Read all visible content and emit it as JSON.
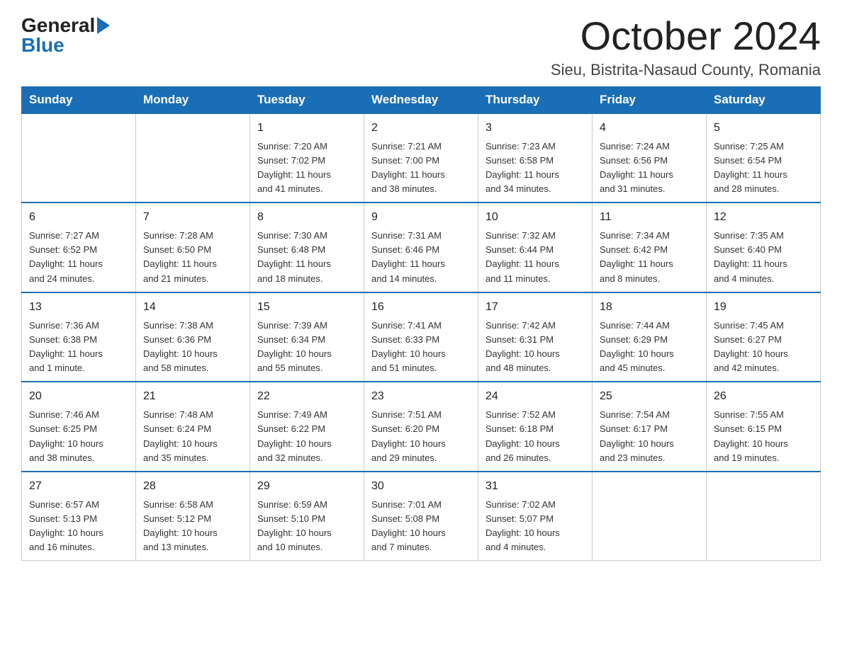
{
  "header": {
    "logo_general": "General",
    "logo_blue": "Blue",
    "main_title": "October 2024",
    "subtitle": "Sieu, Bistrita-Nasaud County, Romania"
  },
  "calendar": {
    "days_of_week": [
      "Sunday",
      "Monday",
      "Tuesday",
      "Wednesday",
      "Thursday",
      "Friday",
      "Saturday"
    ],
    "weeks": [
      [
        {
          "day": "",
          "info": ""
        },
        {
          "day": "",
          "info": ""
        },
        {
          "day": "1",
          "info": "Sunrise: 7:20 AM\nSunset: 7:02 PM\nDaylight: 11 hours\nand 41 minutes."
        },
        {
          "day": "2",
          "info": "Sunrise: 7:21 AM\nSunset: 7:00 PM\nDaylight: 11 hours\nand 38 minutes."
        },
        {
          "day": "3",
          "info": "Sunrise: 7:23 AM\nSunset: 6:58 PM\nDaylight: 11 hours\nand 34 minutes."
        },
        {
          "day": "4",
          "info": "Sunrise: 7:24 AM\nSunset: 6:56 PM\nDaylight: 11 hours\nand 31 minutes."
        },
        {
          "day": "5",
          "info": "Sunrise: 7:25 AM\nSunset: 6:54 PM\nDaylight: 11 hours\nand 28 minutes."
        }
      ],
      [
        {
          "day": "6",
          "info": "Sunrise: 7:27 AM\nSunset: 6:52 PM\nDaylight: 11 hours\nand 24 minutes."
        },
        {
          "day": "7",
          "info": "Sunrise: 7:28 AM\nSunset: 6:50 PM\nDaylight: 11 hours\nand 21 minutes."
        },
        {
          "day": "8",
          "info": "Sunrise: 7:30 AM\nSunset: 6:48 PM\nDaylight: 11 hours\nand 18 minutes."
        },
        {
          "day": "9",
          "info": "Sunrise: 7:31 AM\nSunset: 6:46 PM\nDaylight: 11 hours\nand 14 minutes."
        },
        {
          "day": "10",
          "info": "Sunrise: 7:32 AM\nSunset: 6:44 PM\nDaylight: 11 hours\nand 11 minutes."
        },
        {
          "day": "11",
          "info": "Sunrise: 7:34 AM\nSunset: 6:42 PM\nDaylight: 11 hours\nand 8 minutes."
        },
        {
          "day": "12",
          "info": "Sunrise: 7:35 AM\nSunset: 6:40 PM\nDaylight: 11 hours\nand 4 minutes."
        }
      ],
      [
        {
          "day": "13",
          "info": "Sunrise: 7:36 AM\nSunset: 6:38 PM\nDaylight: 11 hours\nand 1 minute."
        },
        {
          "day": "14",
          "info": "Sunrise: 7:38 AM\nSunset: 6:36 PM\nDaylight: 10 hours\nand 58 minutes."
        },
        {
          "day": "15",
          "info": "Sunrise: 7:39 AM\nSunset: 6:34 PM\nDaylight: 10 hours\nand 55 minutes."
        },
        {
          "day": "16",
          "info": "Sunrise: 7:41 AM\nSunset: 6:33 PM\nDaylight: 10 hours\nand 51 minutes."
        },
        {
          "day": "17",
          "info": "Sunrise: 7:42 AM\nSunset: 6:31 PM\nDaylight: 10 hours\nand 48 minutes."
        },
        {
          "day": "18",
          "info": "Sunrise: 7:44 AM\nSunset: 6:29 PM\nDaylight: 10 hours\nand 45 minutes."
        },
        {
          "day": "19",
          "info": "Sunrise: 7:45 AM\nSunset: 6:27 PM\nDaylight: 10 hours\nand 42 minutes."
        }
      ],
      [
        {
          "day": "20",
          "info": "Sunrise: 7:46 AM\nSunset: 6:25 PM\nDaylight: 10 hours\nand 38 minutes."
        },
        {
          "day": "21",
          "info": "Sunrise: 7:48 AM\nSunset: 6:24 PM\nDaylight: 10 hours\nand 35 minutes."
        },
        {
          "day": "22",
          "info": "Sunrise: 7:49 AM\nSunset: 6:22 PM\nDaylight: 10 hours\nand 32 minutes."
        },
        {
          "day": "23",
          "info": "Sunrise: 7:51 AM\nSunset: 6:20 PM\nDaylight: 10 hours\nand 29 minutes."
        },
        {
          "day": "24",
          "info": "Sunrise: 7:52 AM\nSunset: 6:18 PM\nDaylight: 10 hours\nand 26 minutes."
        },
        {
          "day": "25",
          "info": "Sunrise: 7:54 AM\nSunset: 6:17 PM\nDaylight: 10 hours\nand 23 minutes."
        },
        {
          "day": "26",
          "info": "Sunrise: 7:55 AM\nSunset: 6:15 PM\nDaylight: 10 hours\nand 19 minutes."
        }
      ],
      [
        {
          "day": "27",
          "info": "Sunrise: 6:57 AM\nSunset: 5:13 PM\nDaylight: 10 hours\nand 16 minutes."
        },
        {
          "day": "28",
          "info": "Sunrise: 6:58 AM\nSunset: 5:12 PM\nDaylight: 10 hours\nand 13 minutes."
        },
        {
          "day": "29",
          "info": "Sunrise: 6:59 AM\nSunset: 5:10 PM\nDaylight: 10 hours\nand 10 minutes."
        },
        {
          "day": "30",
          "info": "Sunrise: 7:01 AM\nSunset: 5:08 PM\nDaylight: 10 hours\nand 7 minutes."
        },
        {
          "day": "31",
          "info": "Sunrise: 7:02 AM\nSunset: 5:07 PM\nDaylight: 10 hours\nand 4 minutes."
        },
        {
          "day": "",
          "info": ""
        },
        {
          "day": "",
          "info": ""
        }
      ]
    ]
  }
}
